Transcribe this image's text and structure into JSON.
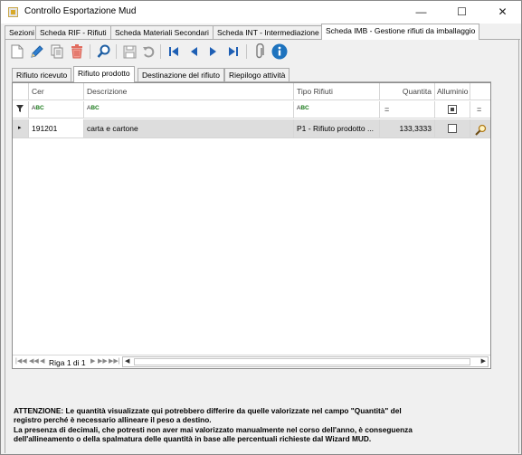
{
  "window": {
    "title": "Controllo Esportazione Mud"
  },
  "outer_tabs": [
    {
      "label": "Sezioni"
    },
    {
      "label": "Scheda RIF - Rifiuti"
    },
    {
      "label": "Scheda Materiali Secondari"
    },
    {
      "label": "Scheda INT - Intermediazione"
    },
    {
      "label": "Scheda IMB - Gestione rifiuti da imballaggio"
    }
  ],
  "inner_tabs": [
    {
      "label": "Rifiuto ricevuto"
    },
    {
      "label": "Rifiuto prodotto"
    },
    {
      "label": "Destinazione del rifiuto"
    },
    {
      "label": "Riepilogo attività"
    }
  ],
  "toolbar": {
    "icons": [
      "new-document-icon",
      "edit-pencil-icon",
      "copy-icon",
      "delete-icon",
      "search-icon",
      "save-icon",
      "undo-icon",
      "first-record-icon",
      "previous-record-icon",
      "next-record-icon",
      "last-record-icon",
      "attachment-icon",
      "info-icon"
    ]
  },
  "grid": {
    "columns": [
      {
        "key": "cer",
        "label": "Cer"
      },
      {
        "key": "descrizione",
        "label": "Descrizione"
      },
      {
        "key": "tipo_rifiuti",
        "label": "Tipo Rifiuti"
      },
      {
        "key": "quantita",
        "label": "Quantita"
      },
      {
        "key": "alluminio",
        "label": "Alluminio"
      }
    ],
    "filter_row": {
      "text_filter": "ABC",
      "numeric_filter": "=",
      "boolean_filter": "="
    },
    "rows": [
      {
        "cer": "191201",
        "descrizione": "carta e cartone",
        "tipo_rifiuti": "P1 - Rifiuto prodotto ...",
        "quantita": "133,3333",
        "alluminio": false
      }
    ],
    "navigator": {
      "page_text": "Riga 1 di 1"
    }
  },
  "notice": {
    "line1": "ATTENZIONE: Le quantità visualizzate qui potrebbero differire da quelle valorizzate nel campo \"Quantità\" del",
    "line2": "registro perché è necessario allineare il peso a destino.",
    "line3": "La presenza di decimali, che potresti non aver mai valorizzato manualmente nel corso dell'anno, è conseguenza",
    "line4": "dell'allineamento o della spalmatura delle quantità in base alle percentuali richieste dal Wizard MUD."
  },
  "colors": {
    "active_tab": "#ffffff",
    "selected_row": "#dddddd",
    "info_icon": "#1e73be"
  }
}
